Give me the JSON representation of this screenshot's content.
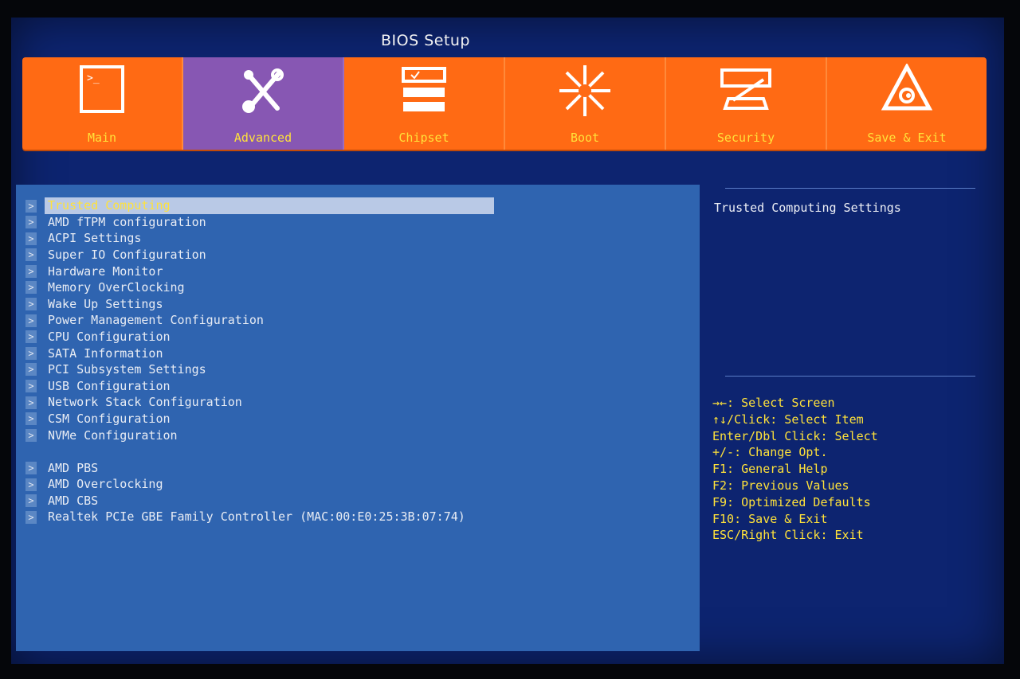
{
  "title": "BIOS Setup",
  "colors": {
    "tab_bar": "#ff6a14",
    "tab_active": "#8757b3",
    "menu_panel": "#2f64b0",
    "screen_bg": "#0d2470",
    "key_text": "#ffe23a"
  },
  "tabs": [
    {
      "label": "Main",
      "icon": "terminal-icon"
    },
    {
      "label": "Advanced",
      "icon": "tools-icon",
      "active": true
    },
    {
      "label": "Chipset",
      "icon": "chipset-icon"
    },
    {
      "label": "Boot",
      "icon": "boot-icon"
    },
    {
      "label": "Security",
      "icon": "security-icon"
    },
    {
      "label": "Save & Exit",
      "icon": "save-exit-icon"
    }
  ],
  "menu": {
    "arrow": ">",
    "items": [
      "Trusted Computing",
      "AMD fTPM configuration",
      "ACPI Settings",
      "Super IO Configuration",
      "Hardware Monitor",
      "Memory OverClocking",
      "Wake Up Settings",
      "Power Management Configuration",
      "CPU Configuration",
      "SATA Information",
      "PCI Subsystem Settings",
      "USB Configuration",
      "Network Stack Configuration",
      "CSM Configuration",
      "NVMe Configuration",
      "AMD PBS",
      "AMD Overclocking",
      "AMD CBS",
      "Realtek PCIe GBE Family Controller (MAC:00:E0:25:3B:07:74)"
    ],
    "selected": "Trusted Computing"
  },
  "help": {
    "description": "Trusted Computing Settings",
    "keys": [
      "→←: Select Screen",
      "↑↓/Click: Select Item",
      "Enter/Dbl Click: Select",
      "+/-: Change Opt.",
      "F1: General Help",
      "F2: Previous Values",
      "F9: Optimized Defaults",
      "F10: Save & Exit",
      "ESC/Right Click: Exit"
    ]
  }
}
